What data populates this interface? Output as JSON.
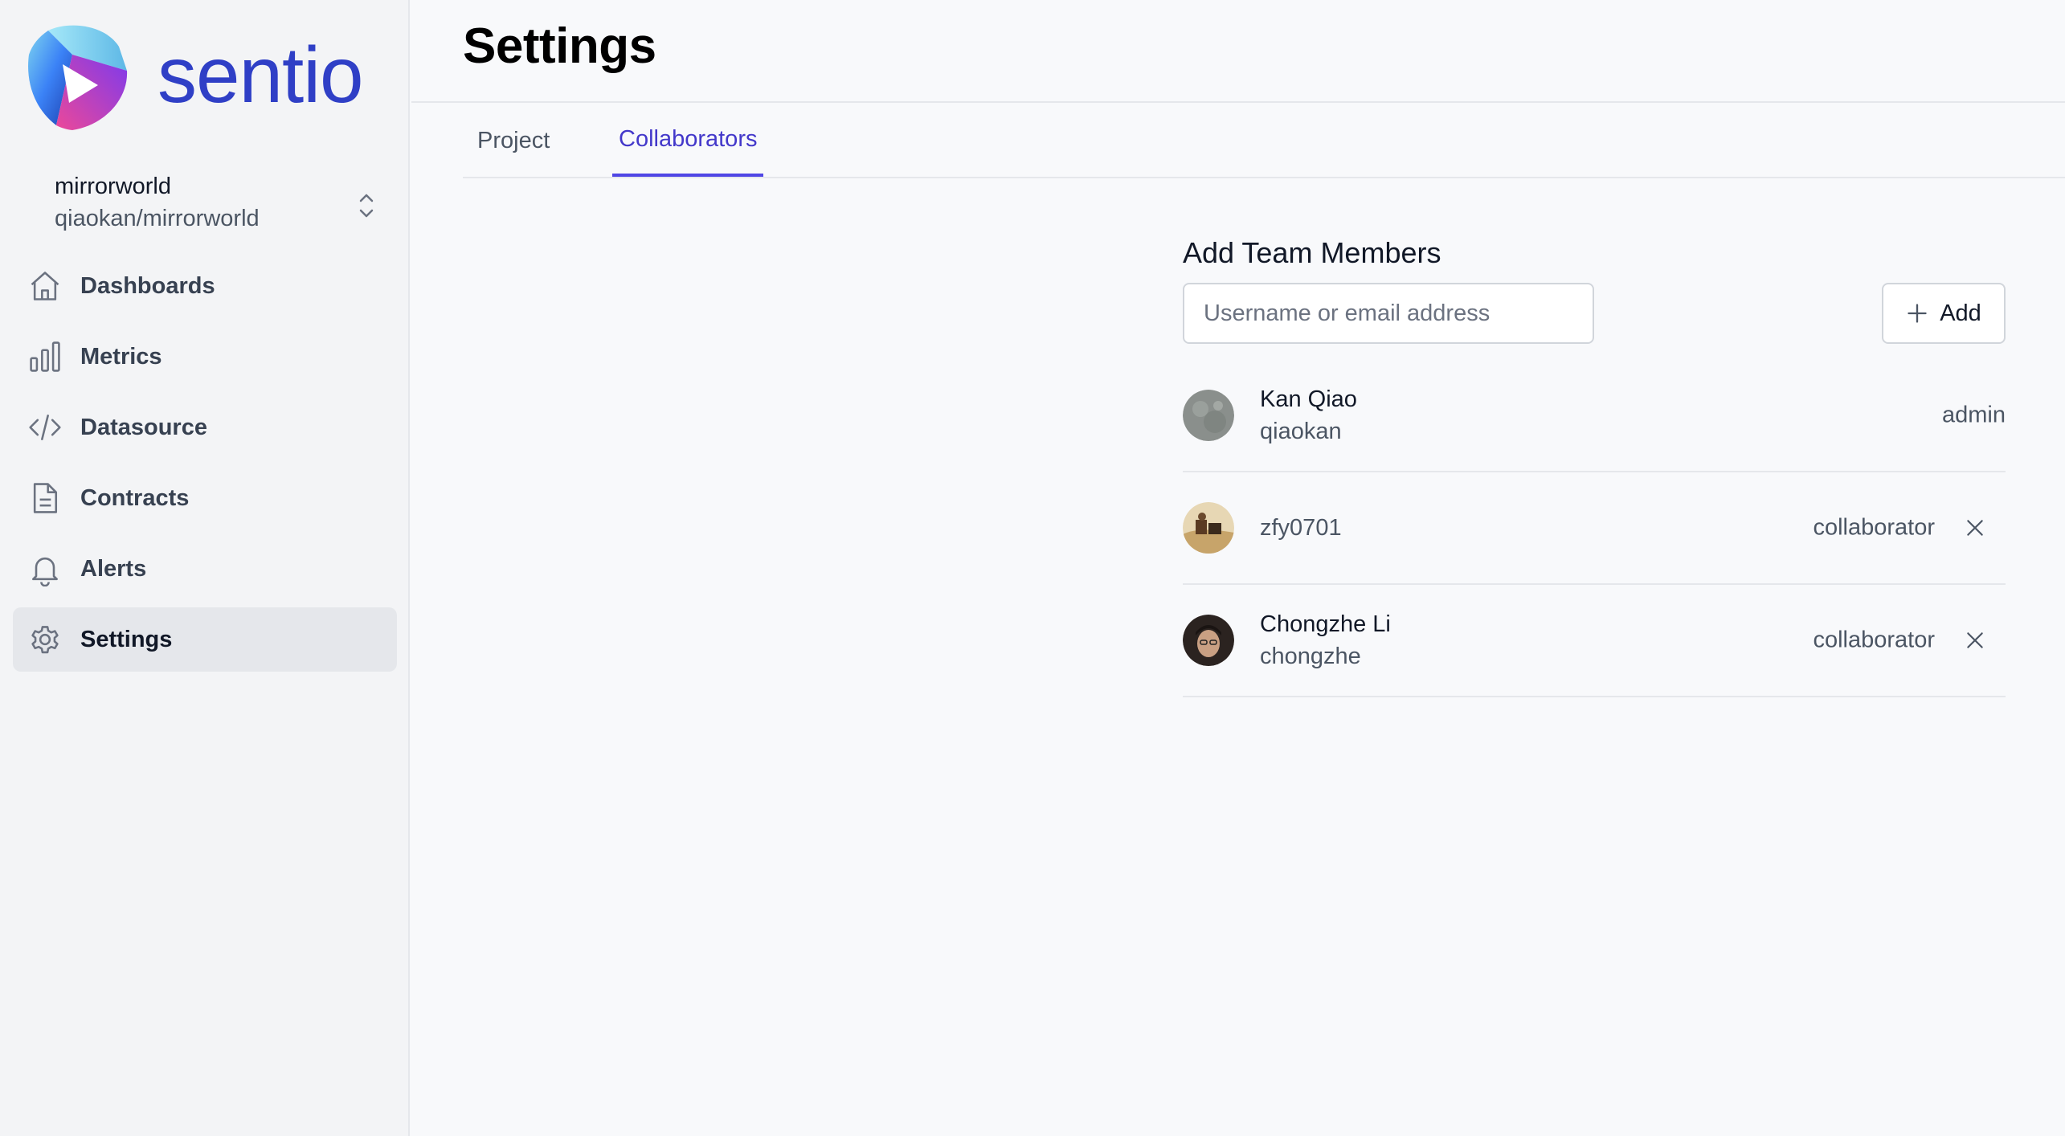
{
  "brand": {
    "name": "sentio",
    "color": "#2f3fc6"
  },
  "project": {
    "name": "mirrorworld",
    "path": "qiaokan/mirrorworld"
  },
  "sidebar": {
    "items": [
      {
        "label": "Dashboards",
        "icon": "home-icon"
      },
      {
        "label": "Metrics",
        "icon": "bar-chart-icon"
      },
      {
        "label": "Datasource",
        "icon": "code-icon"
      },
      {
        "label": "Contracts",
        "icon": "document-icon"
      },
      {
        "label": "Alerts",
        "icon": "bell-icon"
      },
      {
        "label": "Settings",
        "icon": "gear-icon",
        "active": true
      }
    ]
  },
  "header": {
    "title": "Settings"
  },
  "tabs": [
    {
      "label": "Project",
      "active": false
    },
    {
      "label": "Collaborators",
      "active": true
    }
  ],
  "accent_color": "#4f46e5",
  "members_section": {
    "title": "Add Team Members",
    "input": {
      "value": "",
      "placeholder": "Username or email address"
    },
    "add_button_label": "Add",
    "members": [
      {
        "name": "Kan Qiao",
        "username": "qiaokan",
        "role": "admin",
        "removable": false
      },
      {
        "name": "",
        "username": "zfy0701",
        "role": "collaborator",
        "removable": true
      },
      {
        "name": "Chongzhe Li",
        "username": "chongzhe",
        "role": "collaborator",
        "removable": true
      }
    ]
  }
}
